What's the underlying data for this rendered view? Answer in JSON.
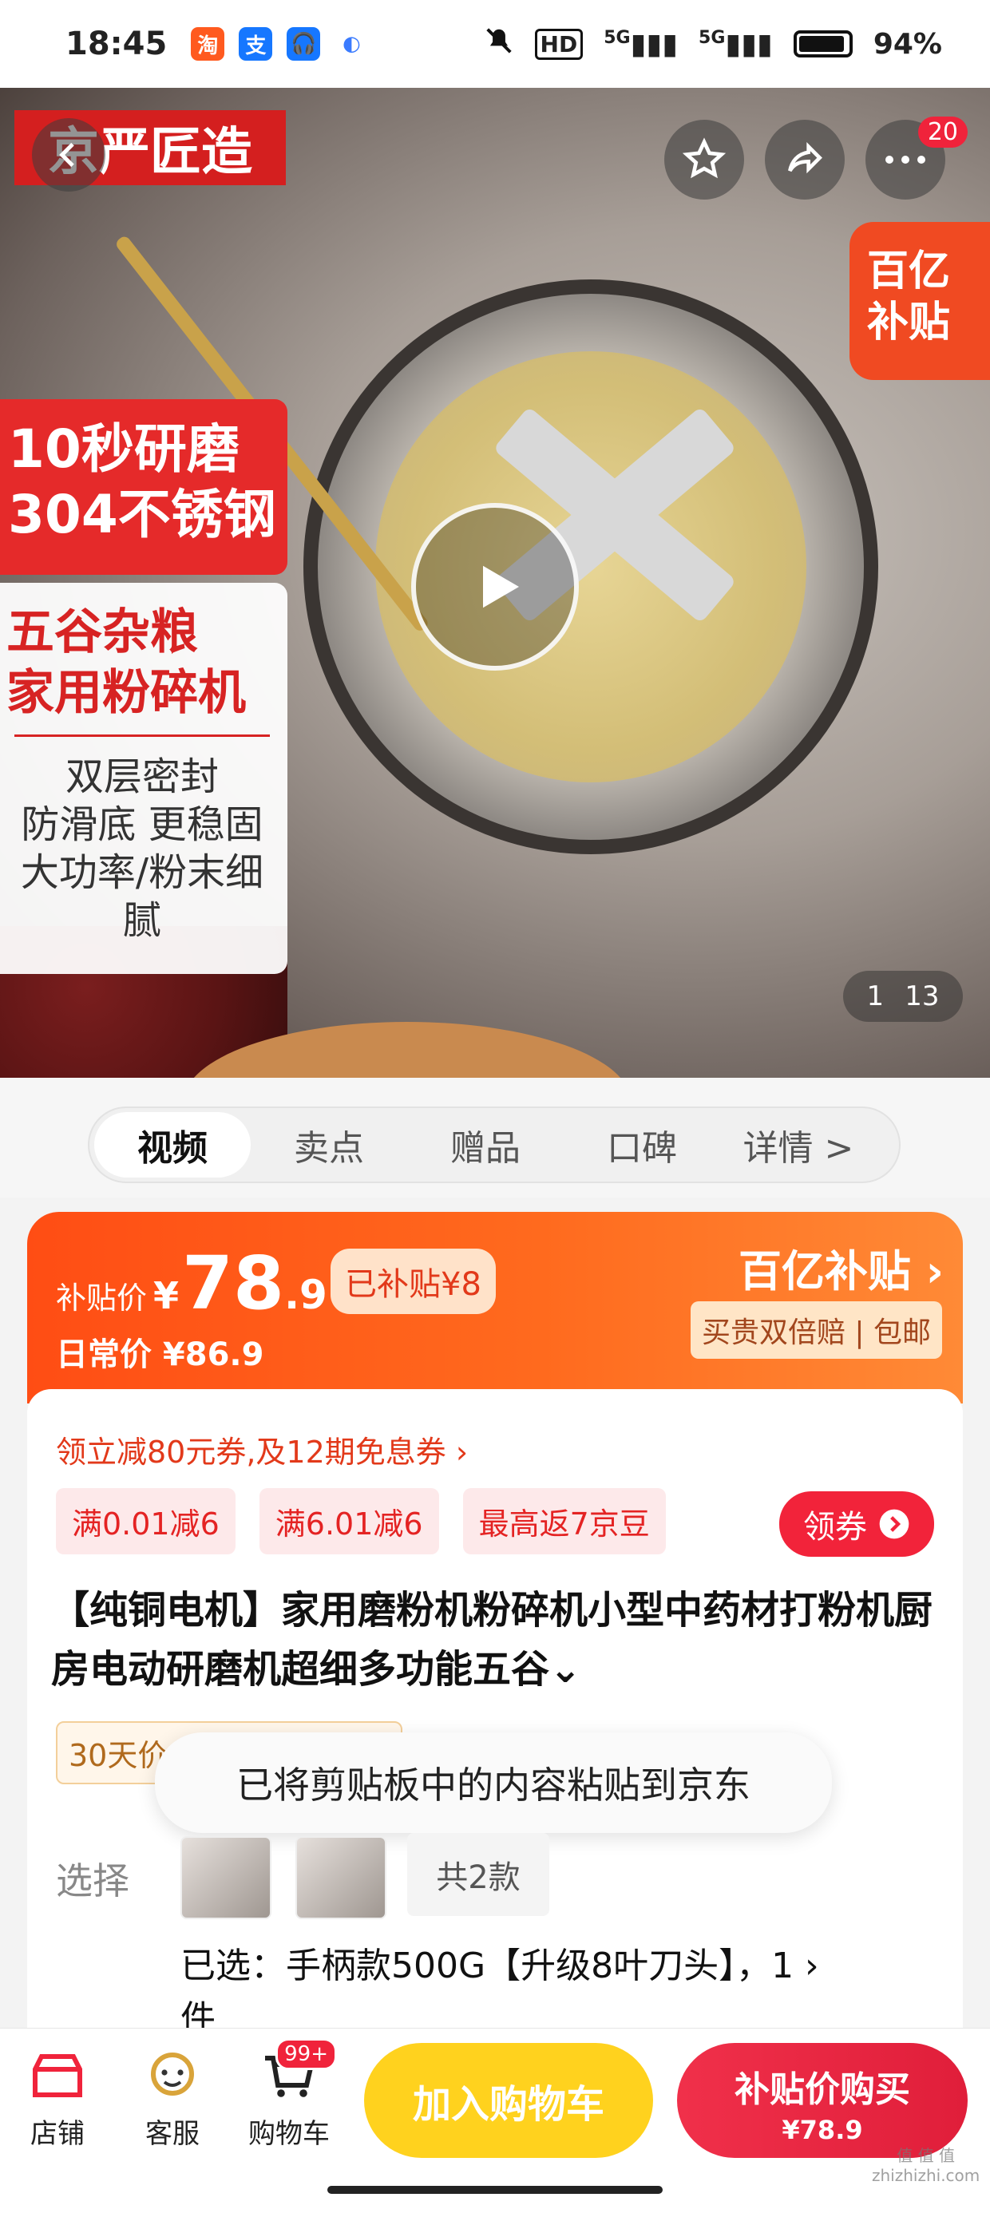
{
  "status_bar": {
    "time": "18:45",
    "apps": [
      {
        "name": "taobao-app",
        "label": "淘",
        "color": "#ff5a1f"
      },
      {
        "name": "alipay-app",
        "label": "支",
        "color": "#1677ff"
      },
      {
        "name": "headset-app",
        "label": "🎧",
        "color": "#1677ff"
      },
      {
        "name": "circle-app",
        "label": "◐",
        "color": "#3a7bff"
      }
    ],
    "hd_label": "HD",
    "signal1": "5G",
    "signal2": "5G",
    "battery": "94%",
    "battery_level": 0.94
  },
  "hero": {
    "brand_label": "京严匠造",
    "red_features": [
      "10秒研磨",
      "304不锈钢"
    ],
    "category_lines": [
      "五谷杂粮",
      "家用粉碎机"
    ],
    "features": [
      "双层密封",
      "防滑底 更稳固",
      "大功率/粉末细腻"
    ],
    "subsidy_lines": [
      "百亿",
      "补贴"
    ],
    "more_badge": "20",
    "page_current": "1",
    "page_total": "13"
  },
  "tabs": [
    {
      "label": "视频",
      "active": true
    },
    {
      "label": "卖点",
      "active": false
    },
    {
      "label": "赠品",
      "active": false
    },
    {
      "label": "口碑",
      "active": false
    },
    {
      "label": "详情 >",
      "active": false
    }
  ],
  "price": {
    "label": "补贴价",
    "currency": "¥",
    "integer": "78",
    "decimal": ".9",
    "subsidy_pill": "已补贴¥8",
    "daily_label": "日常价 ¥86.9",
    "brand": "百亿补贴 ›",
    "brand_sub": "买贵双倍赔 | 包邮"
  },
  "detail": {
    "coupon_line": "领立减80元券,及12期免息券 ›",
    "promos": [
      "满0.01减6",
      "满6.01减6",
      "最高返7京豆"
    ],
    "coupon_button": "领券",
    "title": "【纯铜电机】家用磨粉机粉碎机小型中药材打粉机厨房电动研磨机超细多功能五谷⌄",
    "guarantee_tag": "30天价保  免费上门退换",
    "toast": "已将剪贴板中的内容粘贴到京东",
    "select_label": "选择",
    "variant_count": "共2款",
    "selected_text": "已选：手柄款500G【升级8叶刀头】，1 ›",
    "selected_cont": "件"
  },
  "bottom_bar": {
    "shop_label": "店铺",
    "service_label": "客服",
    "cart_label": "购物车",
    "cart_badge": "99+",
    "add_to_cart": "加入购物车",
    "buy_main": "补贴价购买",
    "buy_sub": "¥78.9"
  },
  "watermark": "值 值 值\nzhizhizhi.com",
  "colors": {
    "accent_orange": "#ff5a1e",
    "accent_red": "#f0233b",
    "cart_yellow": "#ffd21e"
  }
}
